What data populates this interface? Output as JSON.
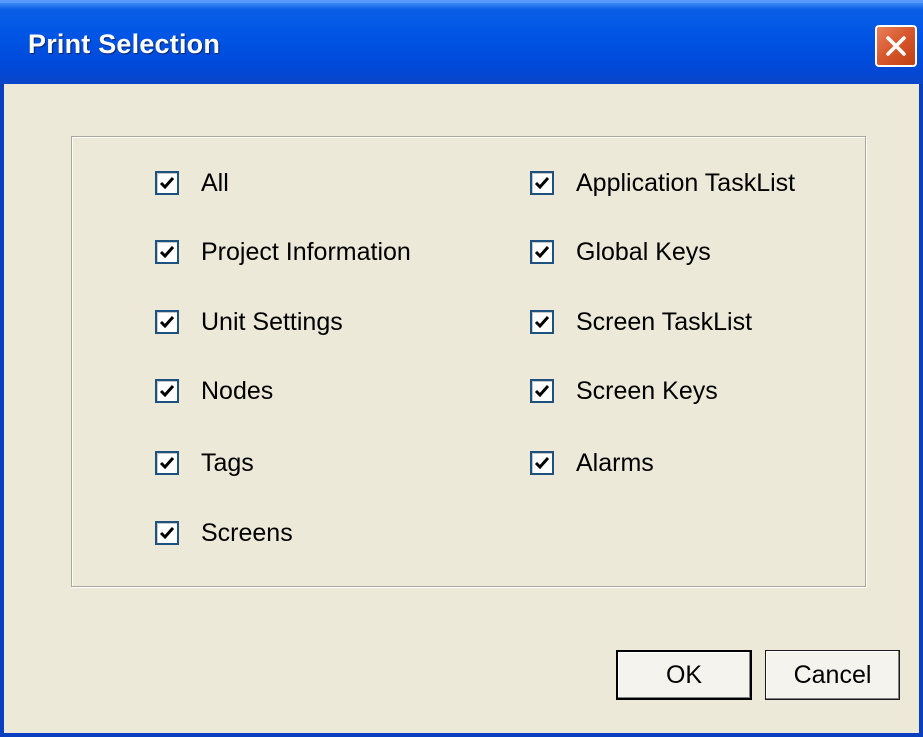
{
  "window": {
    "title": "Print Selection"
  },
  "options_left": [
    {
      "label": "All",
      "checked": true
    },
    {
      "label": "Project Information",
      "checked": true
    },
    {
      "label": "Unit Settings",
      "checked": true
    },
    {
      "label": "Nodes",
      "checked": true
    },
    {
      "label": "Tags",
      "checked": true
    },
    {
      "label": "Screens",
      "checked": true
    }
  ],
  "options_right": [
    {
      "label": "Application TaskList",
      "checked": true
    },
    {
      "label": "Global Keys",
      "checked": true
    },
    {
      "label": "Screen TaskList",
      "checked": true
    },
    {
      "label": "Screen Keys",
      "checked": true
    },
    {
      "label": "Alarms",
      "checked": true
    }
  ],
  "buttons": {
    "ok_label": "OK",
    "cancel_label": "Cancel"
  },
  "icons": {
    "close": "close-icon",
    "check": "checkmark-icon"
  },
  "colors": {
    "titlebar": "#0055e5",
    "close_button": "#d85a2e",
    "dialog_bg": "#ece9d8"
  }
}
